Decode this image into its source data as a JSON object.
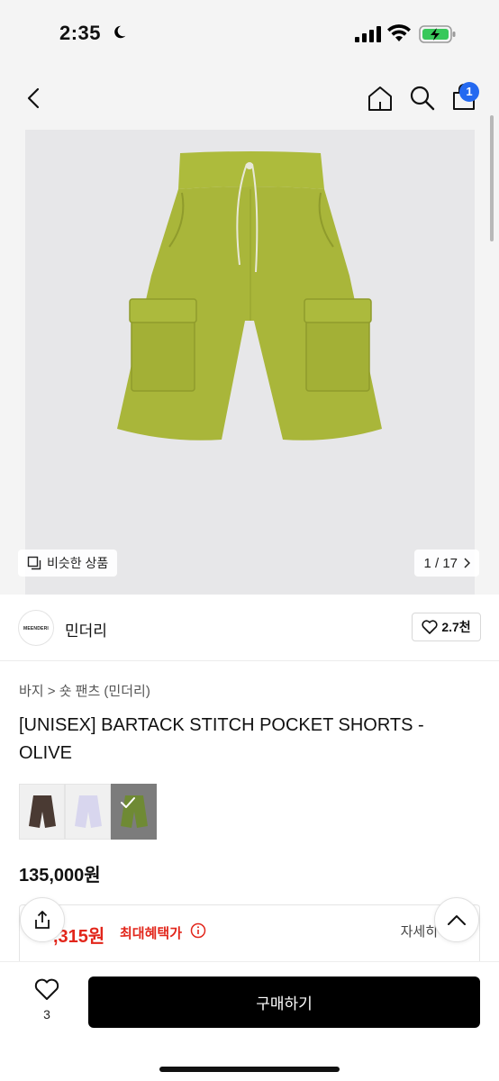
{
  "status": {
    "time": "2:35"
  },
  "nav": {
    "cart_count": "1"
  },
  "gallery": {
    "similar_label": "비슷한 상품",
    "counter": "1 / 17"
  },
  "brand": {
    "logo_text": "MEENDERI",
    "name": "민더리",
    "likes": "2.7천"
  },
  "product": {
    "category": "바지 > 숏 팬츠 (민더리)",
    "title": "[UNISEX] BARTACK STITCH POCKET SHORTS - OLIVE",
    "price": "135,000원",
    "colors": [
      "#4a3a33",
      "#d8d6ee",
      "#6f8a34"
    ],
    "selected_color_index": 2
  },
  "benefit": {
    "price": ",315원",
    "label": "최대혜택가",
    "more": "자세히"
  },
  "bottom": {
    "wish_count": "3",
    "buy_label": "구매하기"
  },
  "colors": {
    "accent_blue": "#2469f0",
    "sale_red": "#e2261b",
    "product_olive": "#a8b43a"
  }
}
